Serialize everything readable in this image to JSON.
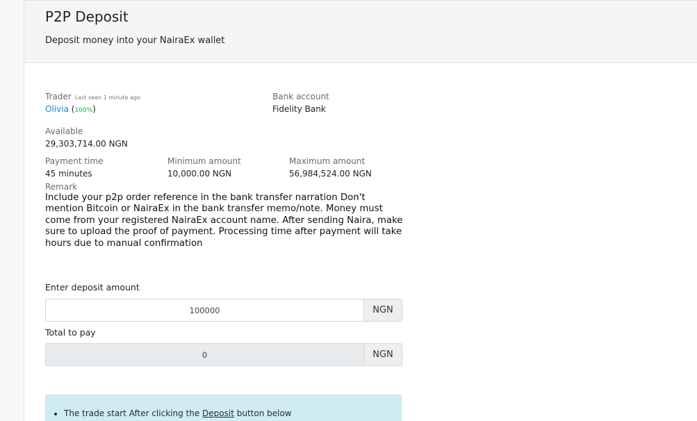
{
  "header": {
    "title": "P2P Deposit",
    "subtitle": "Deposit money into your NairaEx wallet"
  },
  "trader": {
    "label": "Trader",
    "last_seen": "Last seen 1 minute ago",
    "name": "Olivia",
    "paren_open": "(",
    "rating": "100%",
    "paren_close": ")"
  },
  "bank": {
    "label": "Bank account",
    "value": "Fidelity Bank"
  },
  "available": {
    "label": "Available",
    "value": "29,303,714.00 NGN"
  },
  "payment_time": {
    "label": "Payment time",
    "value": "45 minutes"
  },
  "minimum": {
    "label": "Minimum amount",
    "value": "10,000.00 NGN"
  },
  "maximum": {
    "label": "Maximum amount",
    "value": "56,984,524.00 NGN"
  },
  "remark": {
    "label": "Remark",
    "text": "Include your p2p order reference in the bank transfer narration Don't mention Bitcoin or NairaEx in the bank transfer memo/note. Money must come from your registered NairaEx account name. After sending Naira, make sure to upload the proof of payment. Processing time after payment will take hours due to manual confirmation"
  },
  "deposit_amount": {
    "label": "Enter deposit amount",
    "value": "100000",
    "currency": "NGN"
  },
  "total": {
    "label": "Total to pay",
    "value": "0",
    "currency": "NGN"
  },
  "alert": {
    "text_before": "The trade start After clicking the ",
    "link": "Deposit",
    "text_after": " button below"
  },
  "colors": {
    "link": "#1e7fd6",
    "rating": "#2aa84a",
    "alert_bg": "#d1ecf1"
  }
}
